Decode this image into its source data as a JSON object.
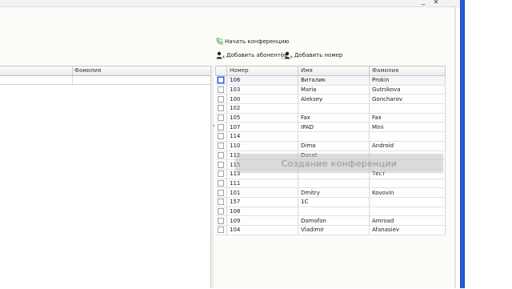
{
  "toolbar": {
    "start_conference": "Начать конференцию",
    "add_subscribers": "Добавить абонентов",
    "add_number": "Добавить номер"
  },
  "left_table": {
    "columns": [
      "",
      "Фамилия"
    ]
  },
  "right_table": {
    "columns": [
      "Номер",
      "Имя",
      "Фамилия"
    ],
    "rows": [
      {
        "number": "106",
        "name": "Виталик",
        "surname": "Prokin"
      },
      {
        "number": "103",
        "name": "Maria",
        "surname": "Gutnikova"
      },
      {
        "number": "100",
        "name": "Aleksey",
        "surname": "Goncharov"
      },
      {
        "number": "102",
        "name": "",
        "surname": ""
      },
      {
        "number": "105",
        "name": "Fax",
        "surname": "Fax"
      },
      {
        "number": "107",
        "name": "IPAD",
        "surname": "Mini"
      },
      {
        "number": "114",
        "name": "",
        "surname": ""
      },
      {
        "number": "110",
        "name": "Dima",
        "surname": "Android"
      },
      {
        "number": "112",
        "name": "Docet",
        "surname": ""
      },
      {
        "number": "115",
        "name": "",
        "surname": ""
      },
      {
        "number": "113",
        "name": "",
        "surname": "Тест"
      },
      {
        "number": "111",
        "name": "",
        "surname": ""
      },
      {
        "number": "101",
        "name": "Dmitry",
        "surname": "Kovovin"
      },
      {
        "number": "157",
        "name": "1C",
        "surname": ""
      },
      {
        "number": "108",
        "name": "",
        "surname": ""
      },
      {
        "number": "109",
        "name": "Domofon",
        "surname": "Amroad"
      },
      {
        "number": "104",
        "name": "Vladimir",
        "surname": "Afanasiev"
      }
    ]
  },
  "overlay": {
    "text": "Создание конференции"
  },
  "colors": {
    "accent": "#2a5ee0",
    "phone_icon": "#2e9c3a"
  },
  "icons": {
    "start_conference": "phone-icon",
    "add_subscribers": "user-add-icon",
    "add_number": "user-add-icon"
  }
}
